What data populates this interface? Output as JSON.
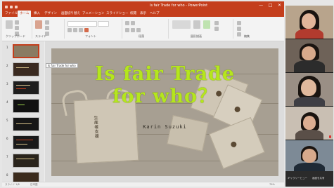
{
  "app": {
    "window_title": "Is fair Trade for who - PowerPoint",
    "quick_access": [
      "save-icon",
      "undo-icon",
      "redo-icon"
    ],
    "window_controls": [
      "—",
      "□",
      "✕"
    ]
  },
  "ribbon": {
    "tabs": [
      {
        "label": "ファイル",
        "active": false
      },
      {
        "label": "ホーム",
        "active": true
      },
      {
        "label": "挿入",
        "active": false
      },
      {
        "label": "デザイン",
        "active": false
      },
      {
        "label": "画面切り替え",
        "active": false
      },
      {
        "label": "アニメーション",
        "active": false
      },
      {
        "label": "スライドショー",
        "active": false
      },
      {
        "label": "校閲",
        "active": false
      },
      {
        "label": "表示",
        "active": false
      },
      {
        "label": "ヘルプ",
        "active": false
      }
    ],
    "groups": [
      "クリップボード",
      "スライド",
      "フォント",
      "段落",
      "図形描画",
      "編集"
    ]
  },
  "thumbnails": {
    "numbers": [
      "1",
      "2",
      "3",
      "4",
      "5",
      "6",
      "7",
      "8"
    ],
    "selected_index": 0,
    "hover_label": "Is fair Trade for who"
  },
  "slide": {
    "title_line1": "Is fair Trade",
    "title_line2": "for who？",
    "author": "Karin Suzuki",
    "bag_print": "生産者支援"
  },
  "status": {
    "slide_counter": "スライド 1/8",
    "language": "日本語",
    "zoom": "79%"
  },
  "participants": [
    {
      "name": "",
      "muted": false
    },
    {
      "name": "",
      "muted": false
    },
    {
      "name": "",
      "muted": false
    },
    {
      "name": "",
      "muted": true
    },
    {
      "name": "",
      "muted": false
    }
  ],
  "meeting_bar": {
    "labels": [
      "ギャラリービュー",
      "画面を共有"
    ]
  },
  "colors": {
    "powerpoint_accent": "#c43e1c",
    "title_text": "#b5e61d"
  }
}
